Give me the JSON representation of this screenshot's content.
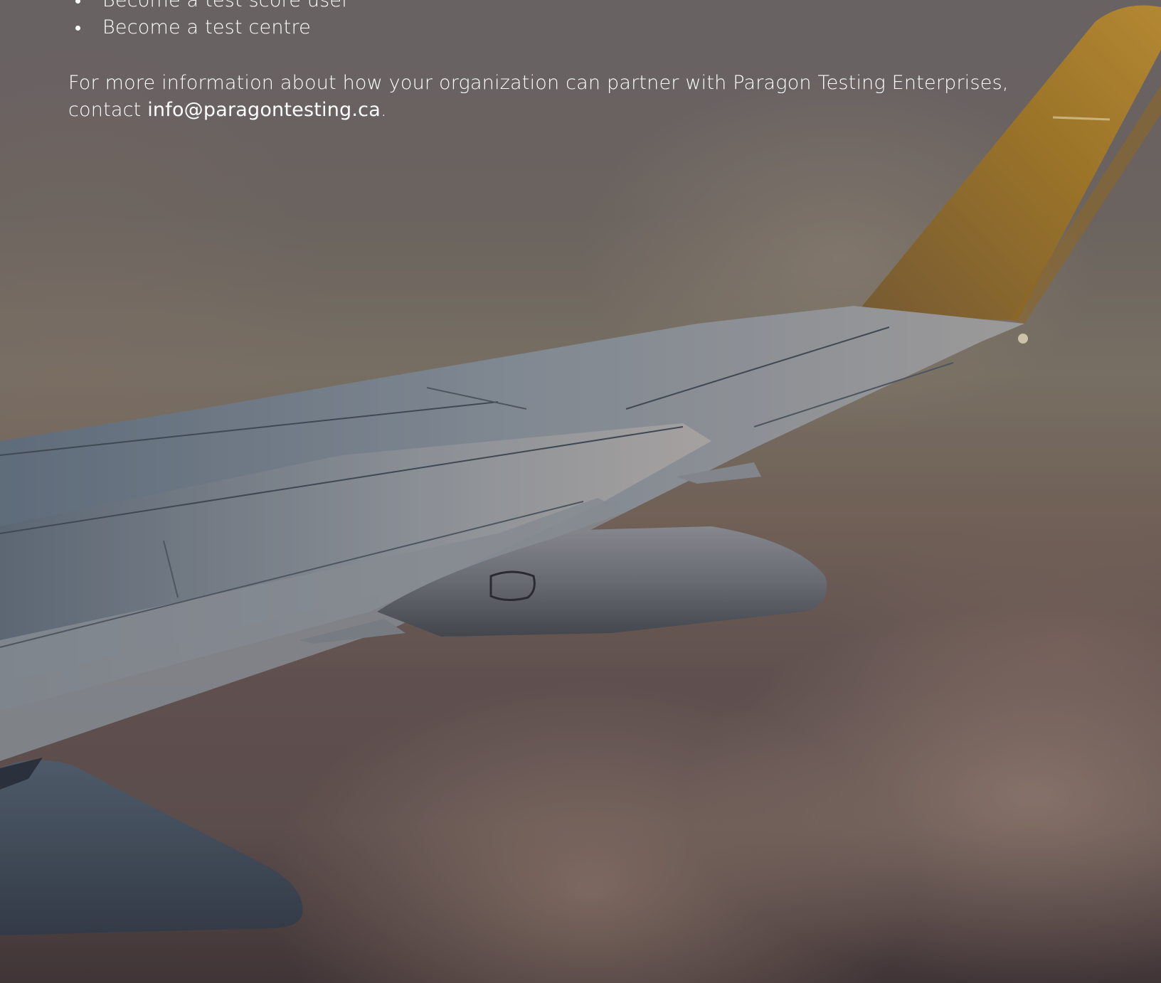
{
  "list": {
    "items": [
      {
        "label": "Become a test score user"
      },
      {
        "label": "Become a test centre"
      }
    ]
  },
  "info": {
    "text": "For more information about how your organization can partner with Paragon Testing Enterprises, contact ",
    "email": "info@paragontesting.ca",
    "suffix": "."
  },
  "colors": {
    "text": "#ffffff",
    "winglet": "#c08a2a",
    "wing": "#8e9aa8"
  },
  "background": {
    "image": "airplane-wing-above-clouds"
  }
}
